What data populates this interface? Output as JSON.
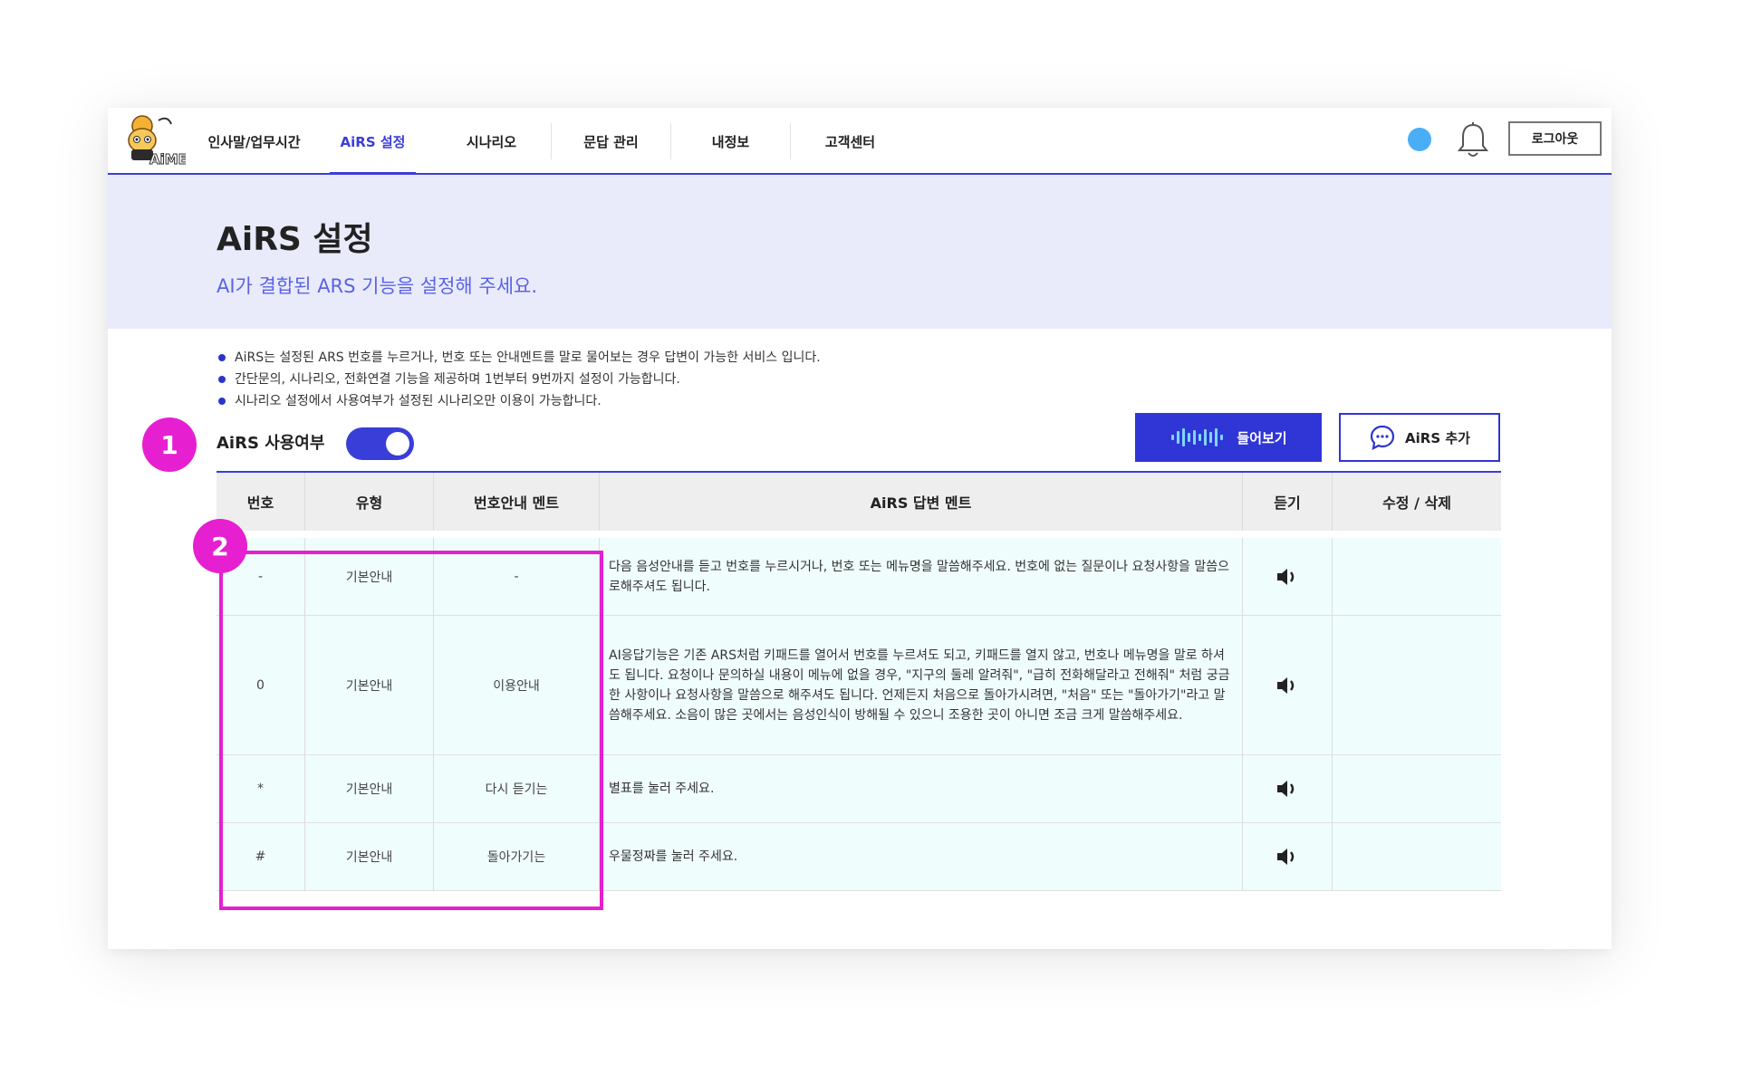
{
  "header": {
    "logo_text": "AiME",
    "nav": [
      {
        "label": "인사말/업무시간",
        "active": false
      },
      {
        "label": "AiRS 설정",
        "active": true
      },
      {
        "label": "시나리오",
        "active": false
      },
      {
        "label": "문답 관리",
        "active": false
      },
      {
        "label": "내정보",
        "active": false
      },
      {
        "label": "고객센터",
        "active": false
      }
    ],
    "logout_label": "로그아웃"
  },
  "hero": {
    "title": "AiRS 설정",
    "subtitle": "AI가 결합된 ARS 기능을 설정해 주세요."
  },
  "notes": [
    "AiRS는 설정된 ARS 번호를 누르거나, 번호 또는 안내멘트를 말로 물어보는 경우 답변이 가능한 서비스 입니다.",
    "간단문의, 시나리오, 전화연결 기능을 제공하며 1번부터 9번까지 설정이 가능합니다.",
    "시나리오 설정에서 사용여부가 설정된 시나리오만 이용이 가능합니다."
  ],
  "usage": {
    "label": "AiRS 사용여부",
    "enabled": true
  },
  "buttons": {
    "listen_label": "들어보기",
    "add_label": "AiRS 추가"
  },
  "markers": [
    "1",
    "2"
  ],
  "table": {
    "headers": [
      "번호",
      "유형",
      "번호안내 멘트",
      "AiRS 답변 멘트",
      "듣기",
      "수정 / 삭제"
    ],
    "rows": [
      {
        "no": "-",
        "type": "기본안내",
        "guide": "-",
        "answer": "다음 음성안내를 듣고 번호를 누르시거나, 번호 또는 메뉴명을 말씀해주세요. 번호에 없는 질문이나 요청사항을 말씀으로해주셔도 됩니다."
      },
      {
        "no": "0",
        "type": "기본안내",
        "guide": "이용안내",
        "answer": "AI응답기능은 기존 ARS처럼 키패드를 열어서 번호를 누르셔도 되고, 키패드를 열지 않고, 번호나 메뉴명을 말로 하셔도 됩니다. 요청이나 문의하실 내용이 메뉴에 없을 경우, \"지구의 둘레 알려줘\", \"급히 전화해달라고 전해줘\" 처럼 궁금한 사항이나 요청사항을 말씀으로 해주셔도 됩니다. 언제든지 처음으로 돌아가시려면, \"처음\" 또는 \"돌아가기\"라고 말씀해주세요. 소음이 많은 곳에서는 음성인식이 방해될 수 있으니 조용한 곳이 아니면 조금 크게 말씀해주세요."
      },
      {
        "no": "*",
        "type": "기본안내",
        "guide": "다시 듣기는",
        "answer": "별표를 눌러 주세요."
      },
      {
        "no": "#",
        "type": "기본안내",
        "guide": "돌아가기는",
        "answer": "우물정짜를 눌러 주세요."
      }
    ]
  },
  "colors": {
    "accent": "#3a3ed8",
    "hero_bg": "#e9ebfb",
    "subtitle": "#5b63e4",
    "marker": "#e61fd0",
    "status_dot": "#4aaef6",
    "row_bg": "#f0fdfd"
  }
}
